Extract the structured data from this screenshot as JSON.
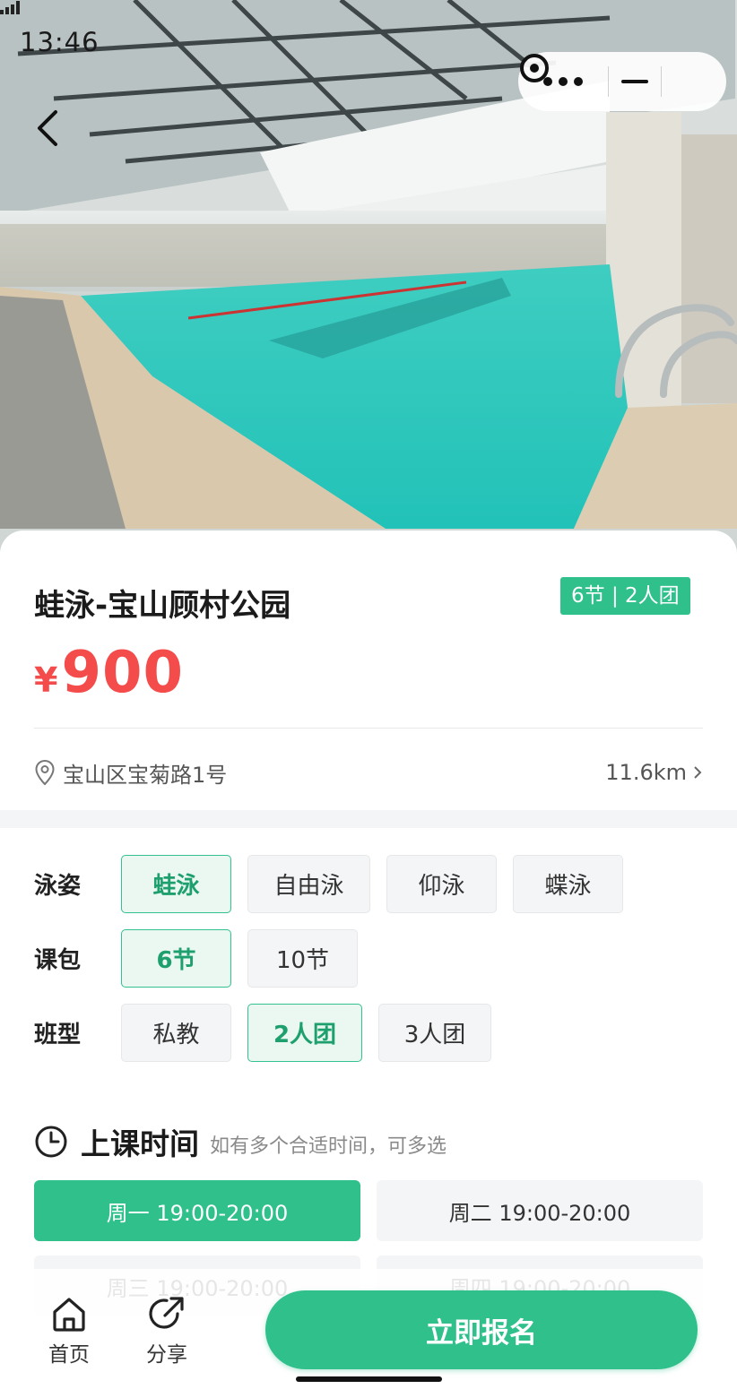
{
  "status_bar": {
    "time": "13:46"
  },
  "header": {
    "back_icon": "chevron-left-icon"
  },
  "capsule": {
    "more_icon": "more-dots-icon",
    "minimize_icon": "minus-icon",
    "close_icon": "target-icon"
  },
  "hero": {
    "image": "indoor-swimming-pool-photo"
  },
  "course": {
    "title": "蛙泳-宝山顾村公园",
    "tag": "6节 | 2人团",
    "currency": "¥",
    "price": "900",
    "address": "宝山区宝菊路1号",
    "distance": "11.6km"
  },
  "options": {
    "stroke": {
      "label": "泳姿",
      "items": [
        "蛙泳",
        "自由泳",
        "仰泳",
        "蝶泳"
      ],
      "selected": 0
    },
    "package": {
      "label": "课包",
      "items": [
        "6节",
        "10节"
      ],
      "selected": 0
    },
    "class_type": {
      "label": "班型",
      "items": [
        "私教",
        "2人团",
        "3人团"
      ],
      "selected": 1
    }
  },
  "schedule": {
    "title": "上课时间",
    "hint": "如有多个合适时间，可多选",
    "slots": [
      "周一 19:00-20:00",
      "周二 19:00-20:00",
      "周三 19:00-20:00",
      "周四 19:00-20:00"
    ],
    "selected": [
      0
    ]
  },
  "bottom_bar": {
    "home_label": "首页",
    "share_label": "分享",
    "signup_label": "立即报名"
  },
  "colors": {
    "accent": "#2fc08c",
    "price": "#f44b4b",
    "chip_bg": "#f4f5f7"
  }
}
